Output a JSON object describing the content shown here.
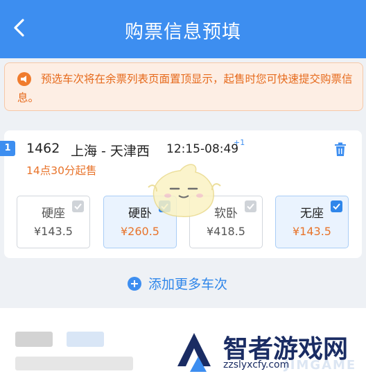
{
  "header": {
    "title": "购票信息预填"
  },
  "notice": {
    "text": "预选车次将在余票列表页面置顶显示，起售时您可快速提交购票信息。"
  },
  "train": {
    "index": "1",
    "number": "1462",
    "route": "上海 - 天津西",
    "time": "12:15-08:49",
    "day_offset": "+1",
    "sale_time": "14点30分起售",
    "seats": [
      {
        "name": "硬座",
        "price": "¥143.5",
        "selected": false
      },
      {
        "name": "硬卧",
        "price": "¥260.5",
        "selected": true
      },
      {
        "name": "软卧",
        "price": "¥418.5",
        "selected": false
      },
      {
        "name": "无座",
        "price": "¥143.5",
        "selected": true
      }
    ]
  },
  "add_more": {
    "label": "添加更多车次"
  },
  "watermark": {
    "brand": "智者游戏网",
    "url": "zzslyxcfy.com",
    "game": "JIMGAME"
  },
  "colors": {
    "primary": "#3d8ef0",
    "accent": "#e8732a",
    "notice_bg": "#fdeee4"
  },
  "icons": {
    "back": "chevron-left-icon",
    "notice": "megaphone-icon",
    "delete": "trash-icon",
    "add": "plus-circle-icon",
    "check": "checkmark-icon"
  }
}
